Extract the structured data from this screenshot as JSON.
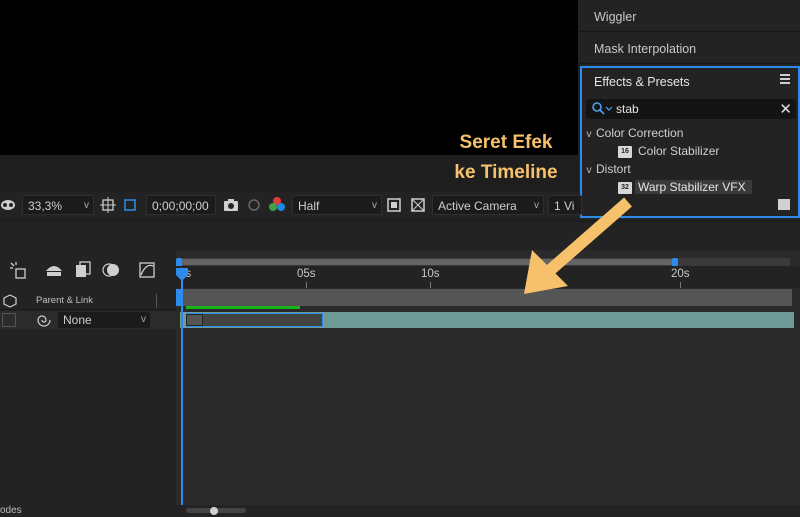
{
  "right_panels": {
    "wiggler_label": "Wiggler",
    "mask_interpolation_label": "Mask Interpolation"
  },
  "effects": {
    "title": "Effects & Presets",
    "search_value": "stab",
    "categories": [
      {
        "label": "Color Correction",
        "items": [
          "Color Stabilizer"
        ]
      },
      {
        "label": "Distort",
        "items": [
          "Warp Stabilizer VFX"
        ]
      }
    ],
    "item_badges": [
      "16",
      "32"
    ]
  },
  "toolbar": {
    "zoom": "33,3%",
    "timecode": "0;00;00;00",
    "resolution": "Half",
    "camera": "Active Camera",
    "views": "1 Vi"
  },
  "timeline": {
    "ruler_labels": [
      "0s",
      "05s",
      "10s",
      "20s"
    ],
    "parent_link_header": "Parent & Link",
    "parent_value": "None"
  },
  "annotation": {
    "line1": "Seret Efek",
    "line2": "ke Timeline"
  },
  "bottom": {
    "label": "odes"
  },
  "colors": {
    "accent": "#2d8ceb",
    "annotation": "#f7c16b",
    "layer_bar": "#6f9a95",
    "green_bar": "#17b31a"
  }
}
